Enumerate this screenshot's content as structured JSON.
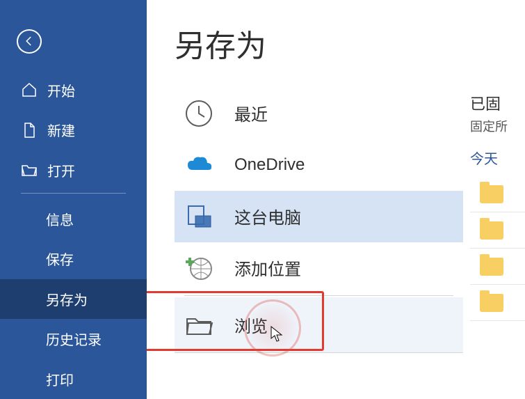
{
  "sidebar": {
    "items": [
      {
        "label": "开始"
      },
      {
        "label": "新建"
      },
      {
        "label": "打开"
      },
      {
        "label": "信息"
      },
      {
        "label": "保存"
      },
      {
        "label": "另存为"
      },
      {
        "label": "历史记录"
      },
      {
        "label": "打印"
      }
    ]
  },
  "page": {
    "title": "另存为"
  },
  "locations": {
    "recent": "最近",
    "onedrive": "OneDrive",
    "this_pc": "这台电脑",
    "add_place": "添加位置",
    "browse": "浏览"
  },
  "right": {
    "pinned_title": "已固",
    "pinned_sub": "固定所",
    "today": "今天"
  },
  "colors": {
    "brand": "#2b579a",
    "accent_red": "#e13b2f",
    "folder": "#f8cf62"
  }
}
